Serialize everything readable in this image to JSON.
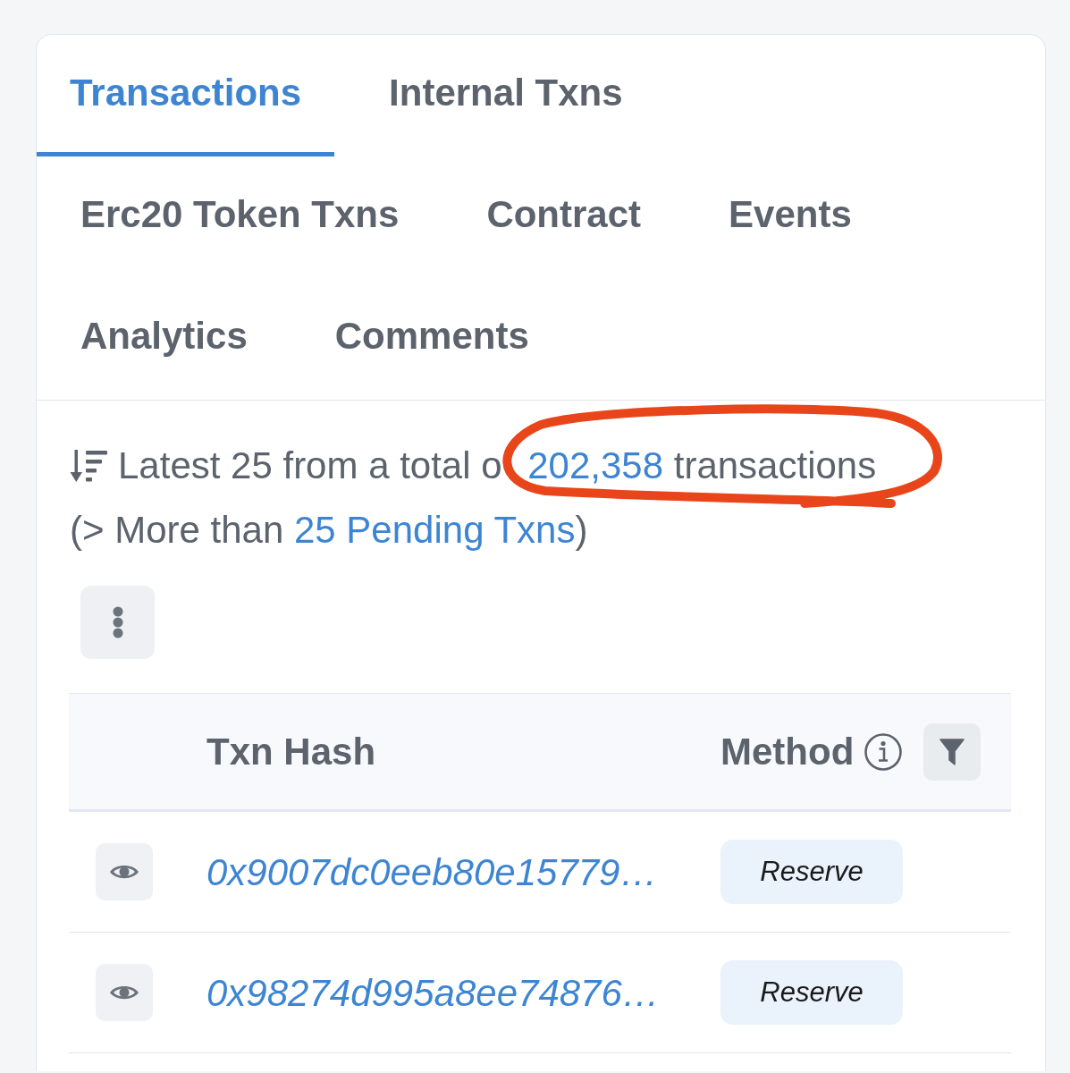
{
  "tabs": [
    {
      "label": "Transactions",
      "selected": true
    },
    {
      "label": "Internal Txns",
      "selected": false
    },
    {
      "label": "Erc20 Token Txns",
      "selected": false
    },
    {
      "label": "Contract",
      "selected": false
    },
    {
      "label": "Events",
      "selected": false
    },
    {
      "label": "Analytics",
      "selected": false
    },
    {
      "label": "Comments",
      "selected": false
    }
  ],
  "summary": {
    "text_before": "Latest 25 from a total o",
    "count_link": "202,358",
    "text_after": "transactions"
  },
  "pending": {
    "text_before": "(> More than",
    "link": "25 Pending Txns",
    "text_after": ")"
  },
  "annotation": {
    "kind": "circle"
  },
  "table": {
    "columns": [
      {
        "label": "Txn Hash",
        "info": false,
        "filter": false
      },
      {
        "label": "Method",
        "info": true,
        "filter": true
      }
    ],
    "rows": [
      {
        "hash": "0x9007dc0eeb80e15779…",
        "method": "Reserve"
      },
      {
        "hash": "0x98274d995a8ee74876…",
        "method": "Reserve"
      }
    ]
  }
}
